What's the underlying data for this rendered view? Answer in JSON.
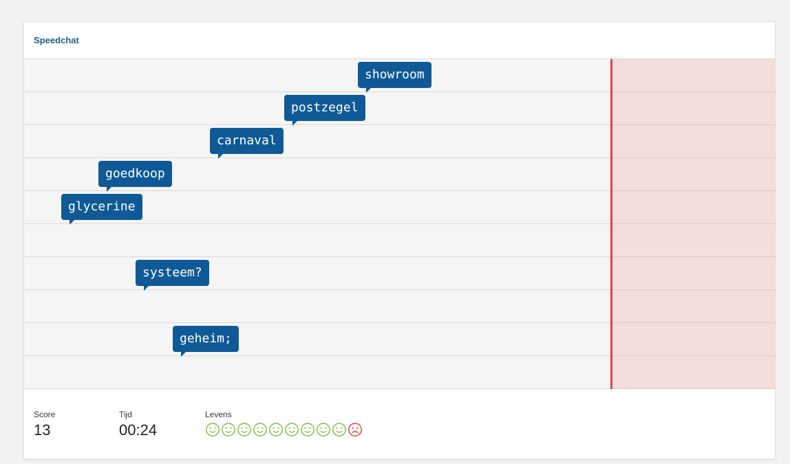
{
  "header": {
    "title": "Speedchat"
  },
  "game": {
    "lanes": 10,
    "words": [
      {
        "text": "showroom",
        "lane": 0
      },
      {
        "text": "postzegel",
        "lane": 1
      },
      {
        "text": "carnaval",
        "lane": 2
      },
      {
        "text": "goedkoop",
        "lane": 3
      },
      {
        "text": "glycerine",
        "lane": 4
      },
      {
        "text": "systeem?",
        "lane": 6
      },
      {
        "text": "geheim;",
        "lane": 8
      }
    ]
  },
  "footer": {
    "score_label": "Score",
    "score_value": "13",
    "time_label": "Tijd",
    "time_value": "00:24",
    "lives_label": "Levens",
    "lives": [
      "happy",
      "happy",
      "happy",
      "happy",
      "happy",
      "happy",
      "happy",
      "happy",
      "happy",
      "sad"
    ]
  },
  "colors": {
    "accent": "#1d5f93",
    "bubble": "#0f5a96",
    "danger": "#e8433a",
    "life_happy": "#7cc242",
    "life_sad": "#e8433a"
  }
}
